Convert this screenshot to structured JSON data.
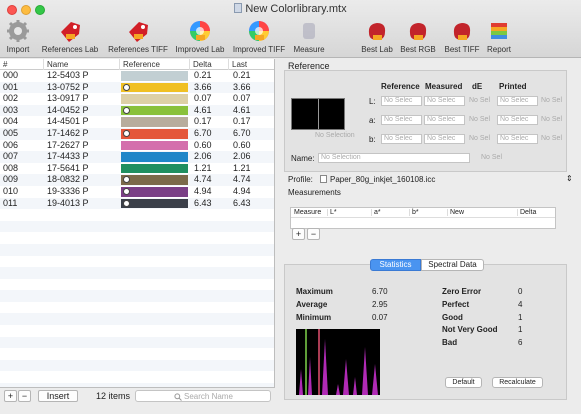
{
  "window": {
    "title": "New Colorlibrary.mtx"
  },
  "toolbar": [
    {
      "label": "Import",
      "icon": "gear-icon"
    },
    {
      "label": "References Lab",
      "icon": "red-tag-icon"
    },
    {
      "label": "References TIFF",
      "icon": "red-tag-tiff-icon"
    },
    {
      "label": "Improved Lab",
      "icon": "color-wheel-icon"
    },
    {
      "label": "Improved TIFF",
      "icon": "color-wheel-tiff-icon"
    },
    {
      "label": "Measure",
      "icon": "measure-icon"
    },
    {
      "label": "Best Lab",
      "icon": "red-blob-icon"
    },
    {
      "label": "Best RGB",
      "icon": "red-blob-rgb-icon"
    },
    {
      "label": "Best TIFF",
      "icon": "red-blob-tiff-icon"
    },
    {
      "label": "Report",
      "icon": "report-icon"
    }
  ],
  "table": {
    "headers": [
      "#",
      "Name",
      "Reference",
      "Delta",
      "Last"
    ],
    "rows": [
      {
        "num": "000",
        "name": "12-5403 P",
        "color": "#c2cfd3",
        "badge": false,
        "delta": "0.21",
        "last": "0.21"
      },
      {
        "num": "001",
        "name": "13-0752 P",
        "color": "#f0c023",
        "badge": true,
        "delta": "3.66",
        "last": "3.66"
      },
      {
        "num": "002",
        "name": "13-0917 P",
        "color": "#ddd0a6",
        "badge": false,
        "delta": "0.07",
        "last": "0.07"
      },
      {
        "num": "003",
        "name": "14-0452 P",
        "color": "#89c13b",
        "badge": true,
        "delta": "4.61",
        "last": "4.61"
      },
      {
        "num": "004",
        "name": "14-4501 P",
        "color": "#b8ad9d",
        "badge": false,
        "delta": "0.17",
        "last": "0.17"
      },
      {
        "num": "005",
        "name": "17-1462 P",
        "color": "#e4563a",
        "badge": true,
        "delta": "6.70",
        "last": "6.70"
      },
      {
        "num": "006",
        "name": "17-2627 P",
        "color": "#d46fac",
        "badge": false,
        "delta": "0.60",
        "last": "0.60"
      },
      {
        "num": "007",
        "name": "17-4433 P",
        "color": "#1f86c8",
        "badge": false,
        "delta": "2.06",
        "last": "2.06"
      },
      {
        "num": "008",
        "name": "17-5641 P",
        "color": "#1f8f60",
        "badge": false,
        "delta": "1.21",
        "last": "1.21"
      },
      {
        "num": "009",
        "name": "18-0832 P",
        "color": "#7b6a4a",
        "badge": true,
        "delta": "4.74",
        "last": "4.74"
      },
      {
        "num": "010",
        "name": "19-3336 P",
        "color": "#7a3f86",
        "badge": true,
        "delta": "4.94",
        "last": "4.94"
      },
      {
        "num": "011",
        "name": "19-4013 P",
        "color": "#3a3f49",
        "badge": true,
        "delta": "6.43",
        "last": "6.43"
      }
    ]
  },
  "footer": {
    "add": "+",
    "remove": "−",
    "insert": "Insert",
    "count": "12 items",
    "search_placeholder": "Search Name"
  },
  "reference": {
    "section_title": "Reference",
    "col_reference": "Reference",
    "col_measured": "Measured",
    "col_de": "dE",
    "col_printed": "Printed",
    "no_selection": "No Selection",
    "l": "L:",
    "a": "a:",
    "b": "b:",
    "field": "No Selec",
    "short": "No Sel",
    "name_label": "Name:",
    "name_value": "No Selection",
    "name_short": "No Sel"
  },
  "profile": {
    "label": "Profile:",
    "value": "Paper_80g_inkjet_160108.icc"
  },
  "measurements": {
    "title": "Measurements",
    "columns": [
      "Measure",
      "L*",
      "a*",
      "b*",
      "New",
      "Delta"
    ],
    "add": "+",
    "remove": "−"
  },
  "stats": {
    "tab_statistics": "Statistics",
    "tab_spectral": "Spectral Data",
    "max_label": "Maximum",
    "max_value": "6.70",
    "avg_label": "Average",
    "avg_value": "2.95",
    "min_label": "Minimum",
    "min_value": "0.07",
    "zero_label": "Zero Error",
    "zero_value": "0",
    "perfect_label": "Perfect",
    "perfect_value": "4",
    "good_label": "Good",
    "good_value": "1",
    "nvg_label": "Not Very Good",
    "nvg_value": "1",
    "bad_label": "Bad",
    "bad_value": "6",
    "default_btn": "Default",
    "recalc_btn": "Recalculate"
  },
  "colors": {
    "accent": "#3b8df0",
    "selected_tab": "#4a94f0"
  }
}
